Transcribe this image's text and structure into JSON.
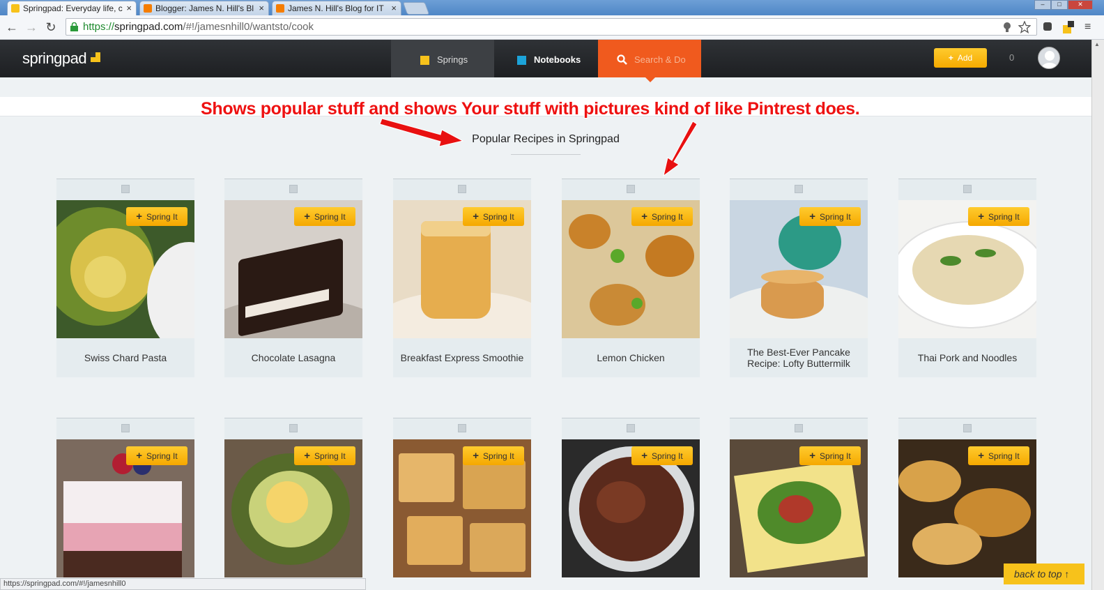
{
  "browser": {
    "tabs": [
      {
        "title": "Springpad: Everyday life, c",
        "active": true
      },
      {
        "title": "Blogger: James N. Hill's Bl",
        "active": false
      },
      {
        "title": "James N. Hill's Blog for IT",
        "active": false
      }
    ],
    "close_glyph": "×",
    "url_scheme": "https://",
    "url_host": "springpad.com",
    "url_path": "/#!/jamesnhill0/wantsto/cook",
    "status_text": "https://springpad.com/#!/jamesnhill0"
  },
  "header": {
    "logo_text": "springpad",
    "nav": {
      "springs": "Springs",
      "notebooks": "Notebooks",
      "search": "Search & Do"
    },
    "add_label": "Add",
    "notification_count": "0"
  },
  "annotation": "Shows popular stuff and shows Your stuff with pictures kind of like Pintrest does.",
  "section_title": "Popular Recipes in Springpad",
  "spring_it_label": "Spring It",
  "recipes_row1": [
    {
      "name": "Swiss Chard Pasta"
    },
    {
      "name": "Chocolate Lasagna"
    },
    {
      "name": "Breakfast Express Smoothie"
    },
    {
      "name": "Lemon Chicken"
    },
    {
      "name": "The Best-Ever Pancake Recipe: Lofty Buttermilk"
    },
    {
      "name": "Thai Pork and Noodles"
    }
  ],
  "back_to_top": "back to top ↑",
  "colors": {
    "accent": "#f7c21b",
    "search_tab": "#f05a1e",
    "annotation": "#ee1111"
  }
}
